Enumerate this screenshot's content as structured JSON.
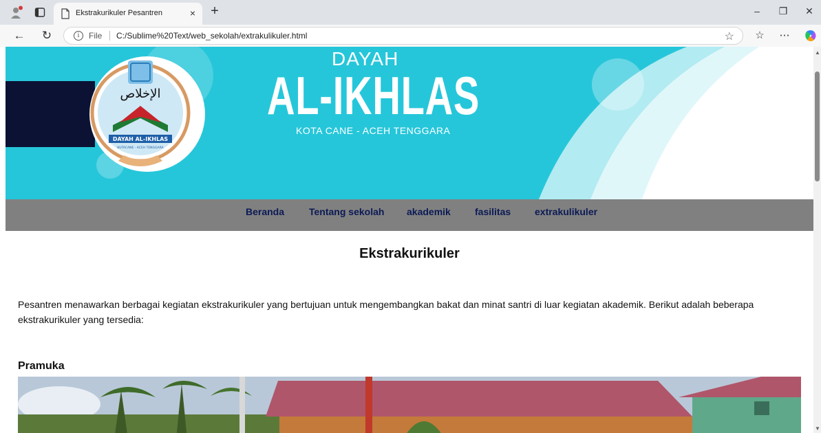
{
  "browser": {
    "tab_title": "Ekstrakurikuler Pesantren",
    "tab_close": "×",
    "new_tab": "+",
    "file_label": "File",
    "url": "C:/Sublime%20Text/web_sekolah/extrakulikuler.html",
    "info_glyph": "i"
  },
  "banner": {
    "dayah": "DAYAH",
    "name": "AL-IKHLAS",
    "city": "KOTA CANE - ACEH TENGGARA",
    "logo_arabic": "الإخلاص",
    "logo_text": "DAYAH AL-IKHLAS",
    "logo_subtext": "KUTACANE - ACEH TENGGARA"
  },
  "nav": {
    "items": [
      "Beranda",
      "Tentang sekolah",
      "akademik",
      "fasilitas",
      "extrakulikuler"
    ]
  },
  "content": {
    "title": "Ekstrakurikuler",
    "intro": "Pesantren menawarkan berbagai kegiatan ekstrakurikuler yang bertujuan untuk mengembangkan bakat dan minat santri di luar kegiatan akademik. Berikut adalah beberapa ekstrakurikuler yang tersedia:",
    "sections": [
      {
        "title": "Pramuka"
      }
    ]
  },
  "colors": {
    "banner": "#26c6da",
    "navbar": "#808080",
    "nav_text": "#0b1a55"
  }
}
